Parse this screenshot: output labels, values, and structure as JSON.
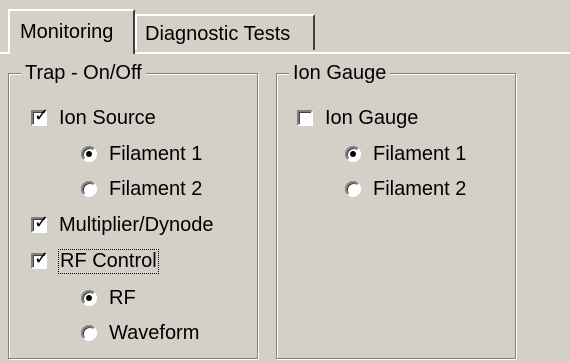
{
  "tabs": [
    {
      "label": "Monitoring",
      "active": true
    },
    {
      "label": "Diagnostic Tests",
      "active": false
    }
  ],
  "trap_group": {
    "title": "Trap - On/Off",
    "ion_source": {
      "label": "Ion Source",
      "checked": true
    },
    "filament_1": {
      "label": "Filament 1",
      "selected": true
    },
    "filament_2": {
      "label": "Filament 2",
      "selected": false
    },
    "multiplier": {
      "label": "Multiplier/Dynode",
      "checked": true
    },
    "rf_control": {
      "label": "RF Control",
      "checked": true
    },
    "rf": {
      "label": "RF",
      "selected": true
    },
    "waveform": {
      "label": "Waveform",
      "selected": false
    }
  },
  "ion_gauge_group": {
    "title": "Ion Gauge",
    "ion_gauge": {
      "label": "Ion Gauge",
      "checked": false
    },
    "filament_1": {
      "label": "Filament 1",
      "selected": true
    },
    "filament_2": {
      "label": "Filament 2",
      "selected": false
    }
  }
}
